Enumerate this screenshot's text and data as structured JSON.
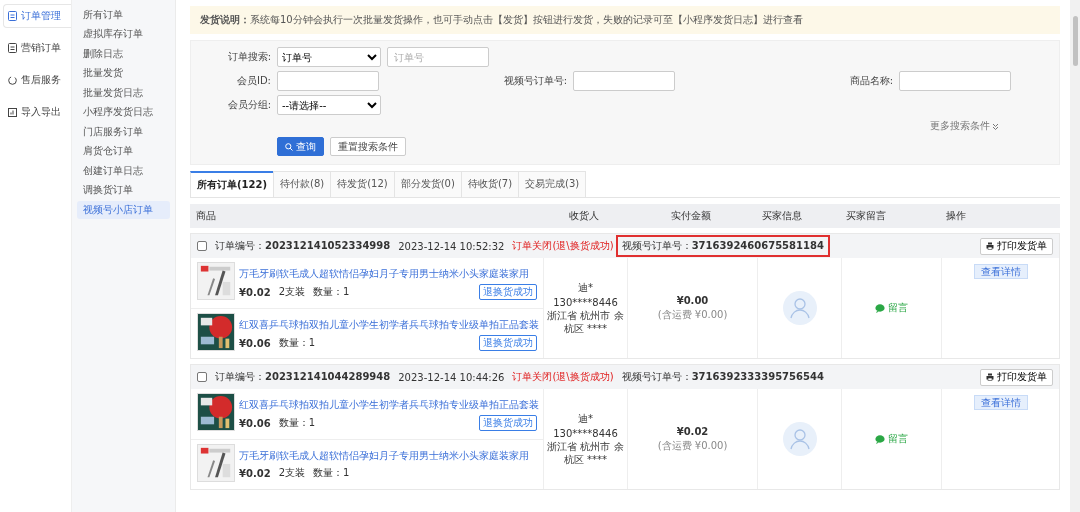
{
  "nav": [
    {
      "label": "订单管理",
      "selected": true
    },
    {
      "label": "营销订单",
      "selected": false
    },
    {
      "label": "售后服务",
      "selected": false
    },
    {
      "label": "导入导出",
      "selected": false
    }
  ],
  "submenu": [
    {
      "label": "所有订单",
      "selected": false
    },
    {
      "label": "虚拟库存订单",
      "selected": false
    },
    {
      "label": "删除日志",
      "selected": false
    },
    {
      "label": "批量发货",
      "selected": false
    },
    {
      "label": "批量发货日志",
      "selected": false
    },
    {
      "label": "小程序发货日志",
      "selected": false
    },
    {
      "label": "门店服务订单",
      "selected": false
    },
    {
      "label": "肩货仓订单",
      "selected": false
    },
    {
      "label": "创建订单日志",
      "selected": false
    },
    {
      "label": "调换货订单",
      "selected": false
    },
    {
      "label": "视频号小店订单",
      "selected": true
    }
  ],
  "notice": {
    "label": "发货说明：",
    "text": "系统每10分钟会执行一次批量发货操作，也可手动点击【发货】按钮进行发货，失败的记录可至【小程序发货日志】进行查看"
  },
  "search": {
    "order_search": {
      "label": "订单搜索:",
      "select": "订单号",
      "placeholder": "订单号"
    },
    "member_id": {
      "label": "会员ID:"
    },
    "video_order": {
      "label": "视频号订单号:"
    },
    "product_name": {
      "label": "商品名称:"
    },
    "member_group": {
      "label": "会员分组:",
      "select": "--请选择--"
    },
    "more": "更多搜索条件",
    "buttons": [
      "查询",
      "重置搜索条件"
    ]
  },
  "tabs": [
    {
      "label": "所有订单(122)",
      "selected": true
    },
    {
      "label": "待付款(8)",
      "selected": false
    },
    {
      "label": "待发货(12)",
      "selected": false
    },
    {
      "label": "部分发货(0)",
      "selected": false
    },
    {
      "label": "待收货(7)",
      "selected": false
    },
    {
      "label": "交易完成(3)",
      "selected": false
    }
  ],
  "columns": [
    "商品",
    "收货人",
    "实付金额",
    "买家信息",
    "买家留言",
    "操作"
  ],
  "orders": [
    {
      "checked": false,
      "no_label": "订单编号：",
      "no": "202312141052334998",
      "time": "2023-12-14 10:52:32",
      "status": "订单关闭(退\\换货成功)",
      "video_label": "视频号订单号：",
      "video_no": "3716392460675581184",
      "highlighted": true,
      "print": "打印发货单",
      "items": [
        {
          "kind": "brush",
          "title": "万毛牙刷软毛成人超软情侣孕妇月子专用男士纳米小头家庭装家用",
          "price": "¥0.02",
          "spec": "2支装",
          "qty": "数量：1",
          "badge": "退换货成功"
        },
        {
          "kind": "paddle",
          "title": "红双喜乒乓球拍双拍儿童小学生初学者兵乓球拍专业级单拍正品套装",
          "price": "¥0.06",
          "qty": "数量：1",
          "badge": "退换货成功"
        }
      ],
      "receiver": {
        "name": "迪*",
        "phone": "130****8446",
        "address": "浙江省 杭州市 余杭区 ****"
      },
      "amount": "¥0.00",
      "shipping": "(含运费 ¥0.00)",
      "message": "留言",
      "detail": "查看详情"
    },
    {
      "checked": false,
      "no_label": "订单编号：",
      "no": "202312141044289948",
      "time": "2023-12-14 10:44:26",
      "status": "订单关闭(退\\换货成功)",
      "video_label": "视频号订单号：",
      "video_no": "3716392333395756544",
      "highlighted": false,
      "print": "打印发货单",
      "items": [
        {
          "kind": "paddle",
          "title": "红双喜乒乓球拍双拍儿童小学生初学者兵乓球拍专业级单拍正品套装",
          "price": "¥0.06",
          "qty": "数量：1",
          "badge": "退换货成功"
        },
        {
          "kind": "brush",
          "title": "万毛牙刷软毛成人超软情侣孕妇月子专用男士纳米小头家庭装家用",
          "price": "¥0.02",
          "spec": "2支装",
          "qty": "数量：1"
        }
      ],
      "receiver": {
        "name": "迪*",
        "phone": "130****8446",
        "address": "浙江省 杭州市 余杭区 ****"
      },
      "amount": "¥0.02",
      "shipping": "(含运费 ¥0.00)",
      "message": "留言",
      "detail": "查看详情"
    }
  ]
}
